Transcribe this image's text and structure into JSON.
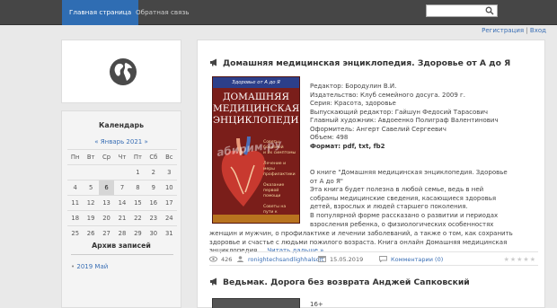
{
  "nav": {
    "home": "Главная страница",
    "feedback": "Обратная связь"
  },
  "search": {
    "value": "",
    "placeholder": ""
  },
  "auth": {
    "register": "Регистрация",
    "separator": "|",
    "login": "Вход"
  },
  "calendar": {
    "title": "Календарь",
    "prev": "«",
    "month": "Январь 2021",
    "next": "»",
    "weekdays": [
      "Пн",
      "Вт",
      "Ср",
      "Чт",
      "Пт",
      "Сб",
      "Вс"
    ],
    "weeks": [
      [
        "",
        "",
        "",
        "",
        "1",
        "2",
        "3"
      ],
      [
        "4",
        "5",
        "6",
        "7",
        "8",
        "9",
        "10"
      ],
      [
        "11",
        "12",
        "13",
        "14",
        "15",
        "16",
        "17"
      ],
      [
        "18",
        "19",
        "20",
        "21",
        "22",
        "23",
        "24"
      ],
      [
        "25",
        "26",
        "27",
        "28",
        "29",
        "30",
        "31"
      ]
    ],
    "today": "6"
  },
  "archive": {
    "title": "Архив записей",
    "items": [
      "2019 Май"
    ]
  },
  "post": {
    "title": "Домашняя медицинская энциклопедия. Здоровье от А до Я",
    "cover": {
      "top": "Здоровье от А до Я",
      "title_lines": [
        "ДОМАШНЯЯ",
        "МЕДИЦИНСКАЯ",
        "ЭНЦИКЛОПЕДИЯ"
      ],
      "side_lines": [
        "Советы",
        "болезней",
        "и их симптомы",
        "",
        "Лечение и меры",
        "профилактики",
        "",
        "Оказание",
        "первой помощи",
        "",
        "Советы на",
        "пути к",
        "бодрости"
      ],
      "watermark": "абирим.ру"
    },
    "meta": [
      "Редактор: Бородулин В.И.",
      "Издательство: Клуб семейного досуга. 2009 г.",
      "Серия: Красота, здоровье",
      "Выпускающий редактор: Гайшун Федосий Тарасович",
      "Главный художник: Авдоеенко Полиграф Валентинович",
      "Оформитель: Ангерт Савелий Сергеевич",
      "Объем: 498",
      "Формат: pdf, txt, fb2"
    ],
    "desc_lines": [
      "О книге \"Домашняя медицинская энциклопедия. Здоровье",
      "от А до Я\"",
      "Эта книга будет полезна в любой семье, ведь в ней",
      "собраны медицинские сведения, касающиеся здоровья",
      "детей, взрослых и людей старшего поколения.",
      "В популярной форме рассказано о развитии и периодах",
      "взросления ребенка, о физиологических особенностях",
      "женщин и мужчин, о профилактике и лечении"
    ],
    "desc_full": "заболеваний, а также о том, как сохранить здоровье и счастье с людьми пожилого возраста. Книга онлайн Домашняя медицинская энциклопедия ...",
    "more": "Читать дальше »",
    "views": "426",
    "author": "ronightechsandlighhalsoft",
    "date": "15.05.2019",
    "comments": "Комментарии (0)",
    "stars": "★★★★★"
  },
  "post2": {
    "title": "Ведьмак. Дорога без возврата Анджей Сапковский",
    "age": "16+"
  }
}
